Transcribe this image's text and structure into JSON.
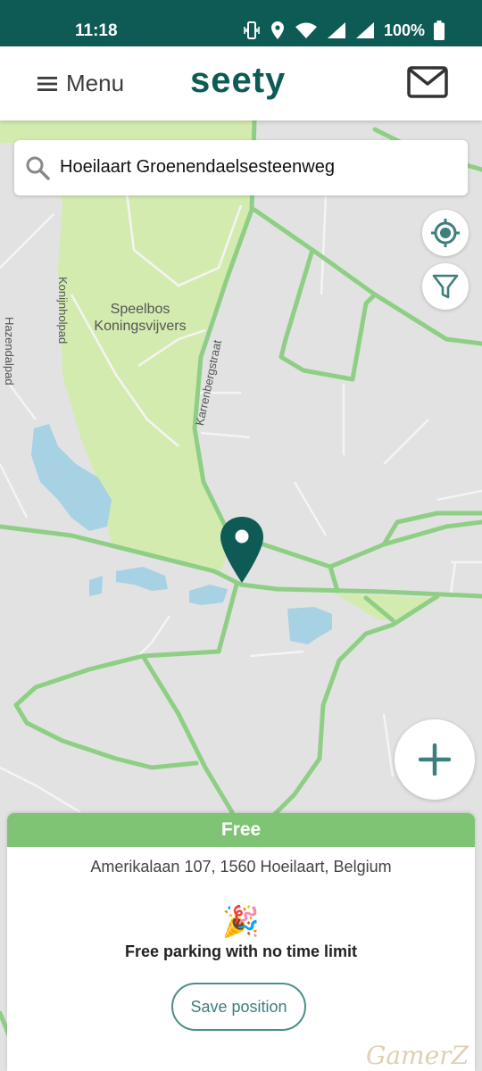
{
  "status_bar": {
    "time": "11:18",
    "battery_text": "100%",
    "icons": [
      "vibrate-icon",
      "location-icon",
      "wifi-icon",
      "signal-icon",
      "signal-icon",
      "battery-icon"
    ]
  },
  "app_bar": {
    "menu_label": "Menu",
    "logo_text": "seety",
    "mail_icon": "mail-icon"
  },
  "search": {
    "value": "Hoeilaart Groenendaelsesteenweg",
    "icon": "search-icon"
  },
  "map": {
    "labels": {
      "park": "Speelbos\nKoningsvijvers",
      "street_konijnholpad": "Konijnholpad",
      "street_hazendalpad": "Hazendalpad",
      "street_karrenbergstraat": "Karrenbergstraat"
    },
    "locate_icon": "locate-icon",
    "filter_icon": "filter-icon",
    "add_icon": "plus-icon",
    "pin_icon": "map-pin-icon"
  },
  "card": {
    "status": "Free",
    "address": "Amerikalaan 107, 1560 Hoeilaart, Belgium",
    "emoji": "🎉",
    "description": "Free parking with no time limit",
    "save_label": "Save position"
  },
  "watermark": "GamerZ",
  "colors": {
    "brand": "#0e5a55",
    "free_green": "#7fc474",
    "road_green": "#8fcf85",
    "park": "#d4ebb0",
    "water": "#a6d2e4"
  }
}
